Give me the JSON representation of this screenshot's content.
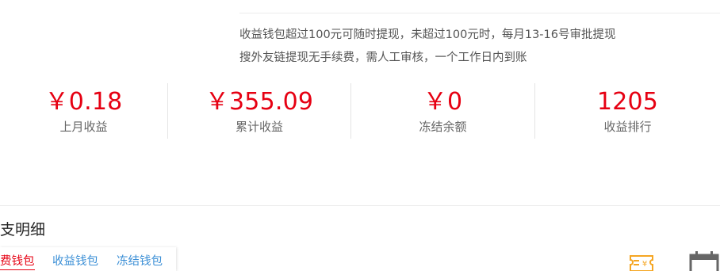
{
  "notice": {
    "line1": "收益钱包超过100元可随时提现，未超过100元时，每月13-16号审批提现",
    "line2": "搜外友链提现无手续费，需人工审核，一个工作日内到账"
  },
  "stats": [
    {
      "value": "￥0.18",
      "label": "上月收益"
    },
    {
      "value": "￥355.09",
      "label": "累计收益"
    },
    {
      "value": "￥0",
      "label": "冻结余额"
    },
    {
      "value": "1205",
      "label": "收益排行"
    }
  ],
  "section": {
    "title": "支明细"
  },
  "tabs": [
    {
      "label": "费钱包",
      "active": true
    },
    {
      "label": "收益钱包",
      "active": false
    },
    {
      "label": "冻结钱包",
      "active": false
    }
  ],
  "icons": {
    "bill": "bill-icon",
    "calendar": "calendar-icon"
  },
  "colors": {
    "accent_red": "#e60012",
    "link_blue": "#3b8fd6",
    "icon_orange": "#f5a623",
    "icon_gray": "#666666"
  }
}
